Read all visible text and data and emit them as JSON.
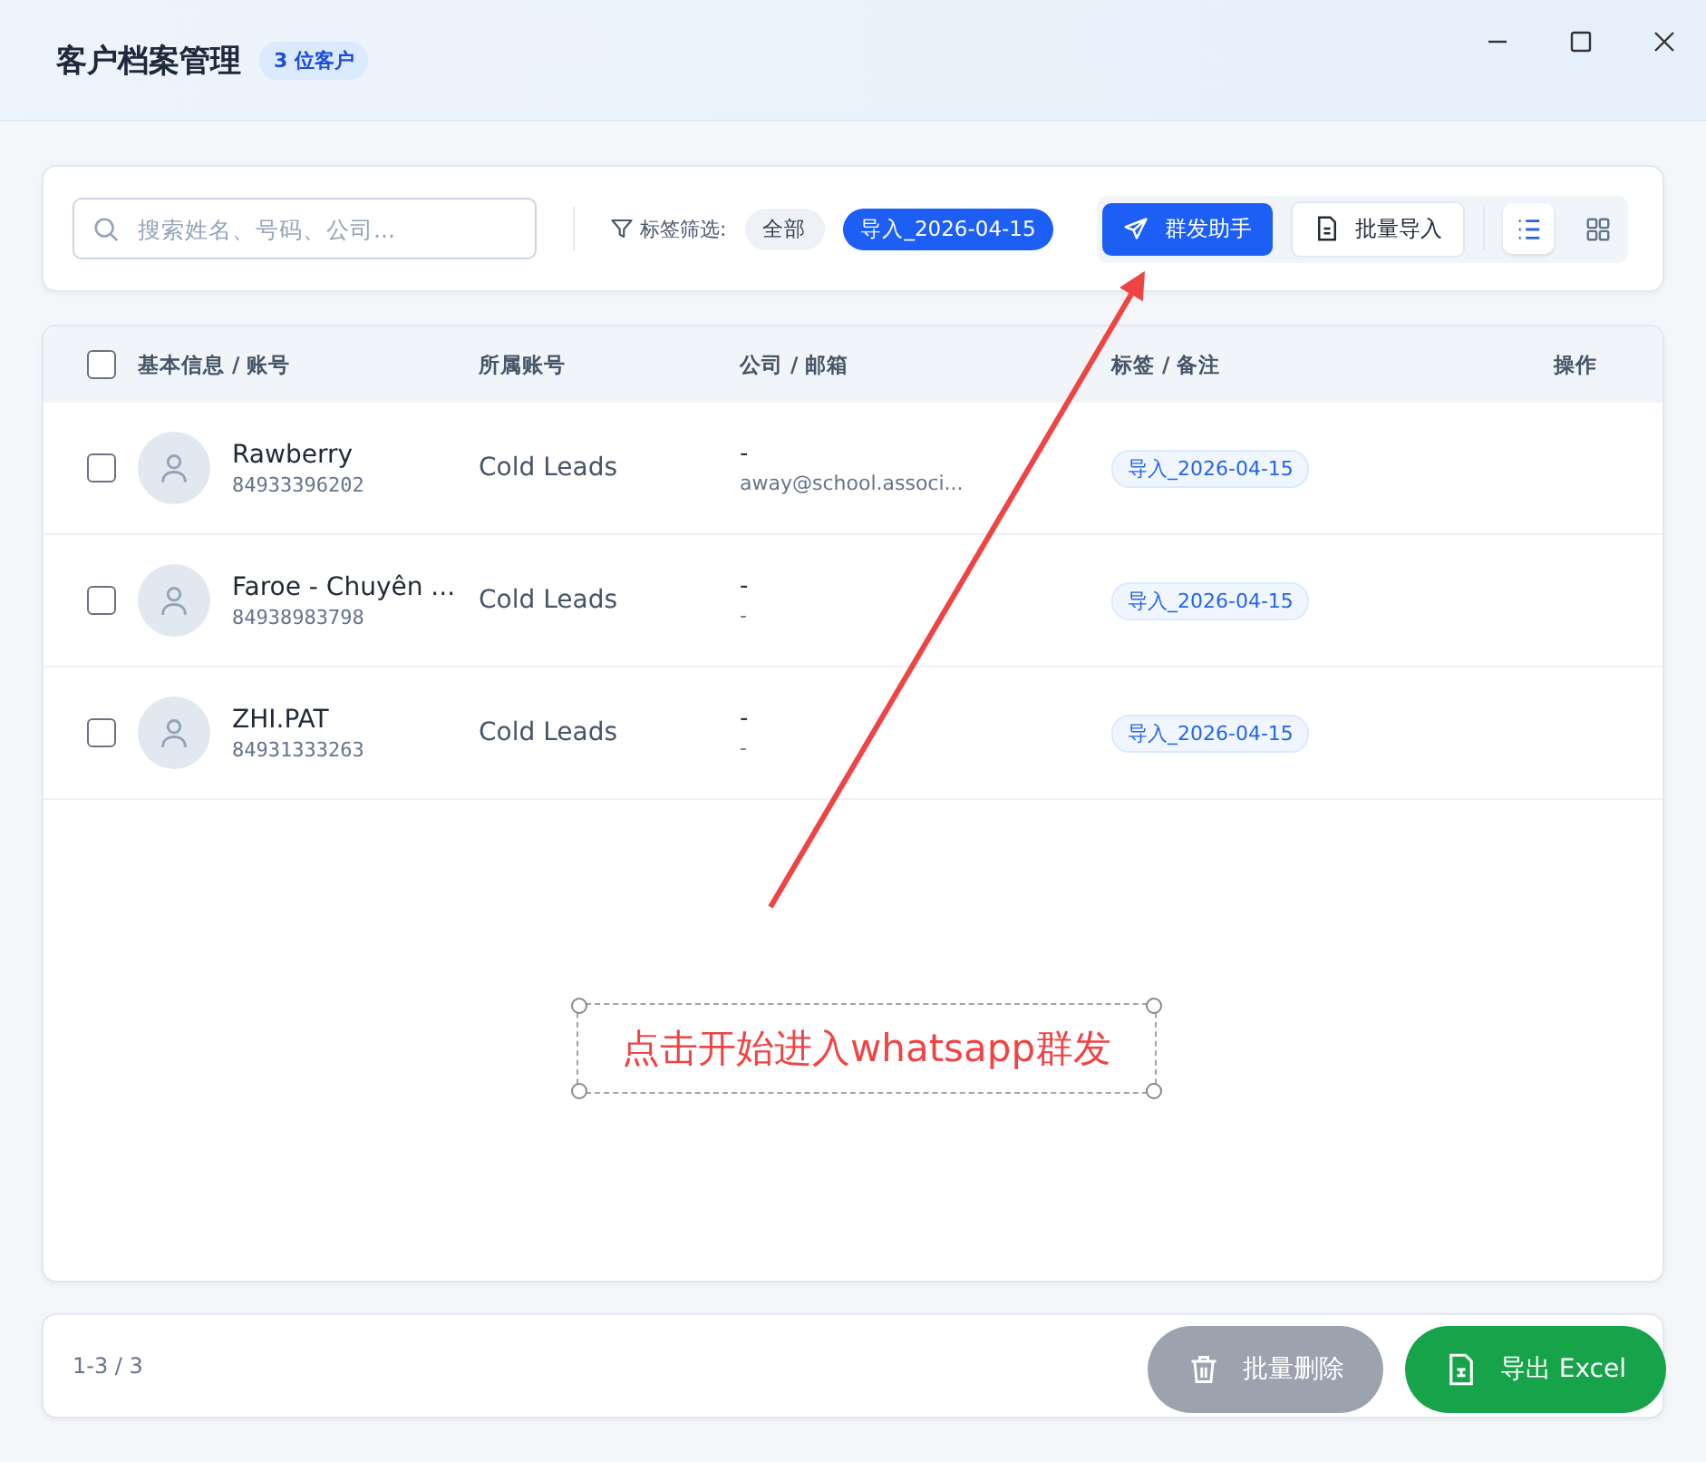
{
  "window": {
    "title": "客户档案管理",
    "badge": "3 位客户"
  },
  "toolbar": {
    "search": {
      "placeholder": "搜索姓名、号码、公司..."
    },
    "filter_label": "标签筛选:",
    "filters": [
      {
        "label": "全部",
        "selected": false
      },
      {
        "label": "导入_2026-04-15",
        "selected": true
      }
    ],
    "buttons": [
      {
        "label": "群发助手",
        "kind": "primary"
      },
      {
        "label": "批量导入",
        "kind": "secondary"
      }
    ],
    "views": [
      {
        "kind": "list",
        "selected": true
      },
      {
        "kind": "grid",
        "selected": false
      }
    ]
  },
  "table": {
    "select_all": false,
    "columns": [
      "基本信息 / 账号",
      "所属账号",
      "公司 / 邮箱",
      "标签 / 备注",
      "操作"
    ],
    "rows": [
      {
        "checked": false,
        "name": "Rawberry",
        "phone": "84933396202",
        "account": "Cold Leads",
        "company": "-",
        "email": "away@school.associ...",
        "tag": "导入_2026-04-15"
      },
      {
        "checked": false,
        "name": "Faroe - Chuyên ...",
        "phone": "84938983798",
        "account": "Cold Leads",
        "company": "-",
        "email": "-",
        "tag": "导入_2026-04-15"
      },
      {
        "checked": false,
        "name": "ZHI.PAT",
        "phone": "84931333263",
        "account": "Cold Leads",
        "company": "-",
        "email": "-",
        "tag": "导入_2026-04-15"
      }
    ]
  },
  "footer": {
    "range": "1-3 / 3"
  },
  "floating_buttons": [
    {
      "label": "批量删除",
      "kind": "delete"
    },
    {
      "label": "导出 Excel",
      "kind": "export"
    }
  ],
  "annotation": {
    "text": "点击开始进入whatsapp群发"
  }
}
